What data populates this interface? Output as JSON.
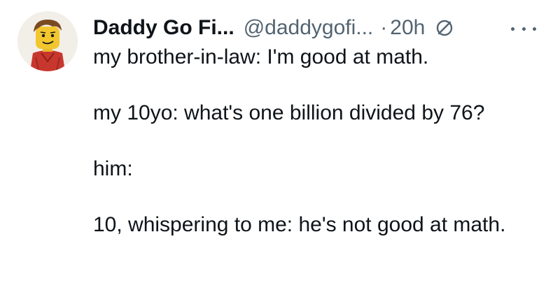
{
  "author": {
    "display_name": "Daddy Go Fi...",
    "handle": "@daddygofi...",
    "separator": "·",
    "timestamp": "20h"
  },
  "icons": {
    "avatar": "avatar-lego-man",
    "badge": "circle-slash-icon",
    "more": "more-horizontal-icon"
  },
  "colors": {
    "text": "#0f1419",
    "secondary": "#536471",
    "avatar_shirt": "#c8372d"
  },
  "tweet": {
    "line1": "my brother-in-law: I'm good at math.",
    "line2": "my 10yo: what's one billion divided by 76?",
    "line3": "him:",
    "line4": "10, whispering to me: he's not good at math."
  }
}
